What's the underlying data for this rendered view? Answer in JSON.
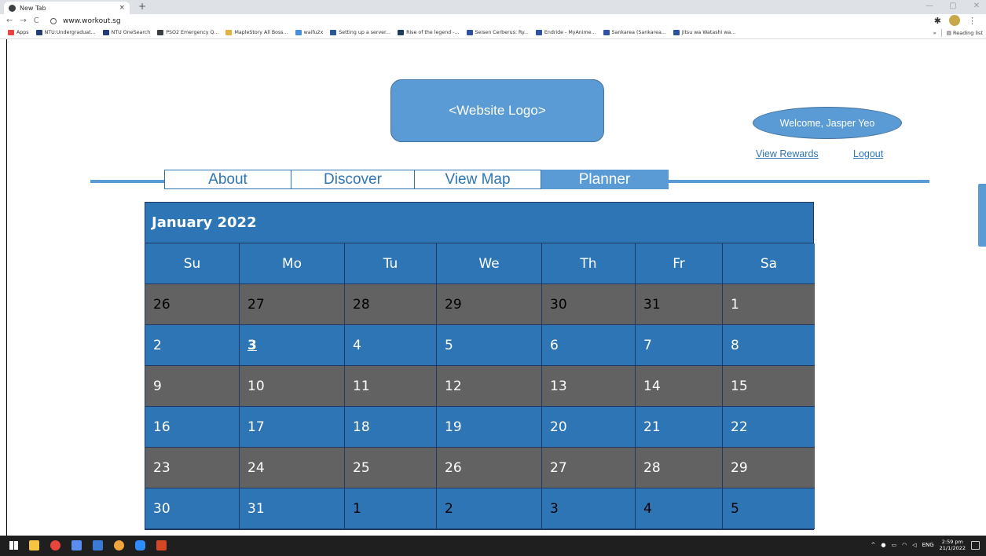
{
  "browser": {
    "tab_title": "New Tab",
    "tab_close": "×",
    "new_tab": "+",
    "url": "www.workout.sg",
    "nav_back": "←",
    "nav_forward": "→",
    "nav_reload": "C",
    "win_min": "—",
    "win_max": "▢",
    "win_close": "✕",
    "menu": "⋮",
    "bookmarks": [
      {
        "label": "Apps",
        "color": "#e8453c"
      },
      {
        "label": "NTU:Undergraduat...",
        "color": "#243c7c"
      },
      {
        "label": "NTU OneSearch",
        "color": "#243c7c"
      },
      {
        "label": "PSO2 Emergency Q...",
        "color": "#3c4043"
      },
      {
        "label": "MapleStory All Boss...",
        "color": "#e0b33c"
      },
      {
        "label": "waifu2x",
        "color": "#4a90d9"
      },
      {
        "label": "Setting up a server...",
        "color": "#2b5797"
      },
      {
        "label": "Rise of the legend -...",
        "color": "#1d3c5c"
      },
      {
        "label": "Seisen Cerberus: Ry...",
        "color": "#2e51a2"
      },
      {
        "label": "Endride - MyAnime...",
        "color": "#2e51a2"
      },
      {
        "label": "Sankarea (Sankarea...",
        "color": "#2e51a2"
      },
      {
        "label": "Jitsu wa Watashi wa...",
        "color": "#2e51a2"
      }
    ],
    "bookmarks_more": "»",
    "reading_list": "Reading list"
  },
  "site": {
    "logo_text": "<Website Logo>",
    "welcome_text": "Welcome, Jasper Yeo",
    "view_rewards": "View Rewards",
    "logout": "Logout",
    "nav": {
      "about": "About",
      "discover": "Discover",
      "view_map": "View Map",
      "planner": "Planner"
    },
    "active_tab": "Planner"
  },
  "calendar": {
    "title": "January 2022",
    "days_of_week": [
      "Su",
      "Mo",
      "Tu",
      "We",
      "Th",
      "Fr",
      "Sa"
    ],
    "selected_day": "3",
    "weeks": [
      [
        "26",
        "27",
        "28",
        "29",
        "30",
        "31",
        "1"
      ],
      [
        "2",
        "3",
        "4",
        "5",
        "6",
        "7",
        "8"
      ],
      [
        "9",
        "10",
        "11",
        "12",
        "13",
        "14",
        "15"
      ],
      [
        "16",
        "17",
        "18",
        "19",
        "20",
        "21",
        "22"
      ],
      [
        "23",
        "24",
        "25",
        "26",
        "27",
        "28",
        "29"
      ],
      [
        "30",
        "31",
        "1",
        "2",
        "3",
        "4",
        "5"
      ]
    ]
  },
  "taskbar": {
    "language": "ENG",
    "time": "2:59 pm",
    "date": "21/1/2022",
    "tray_arrow": "^"
  }
}
